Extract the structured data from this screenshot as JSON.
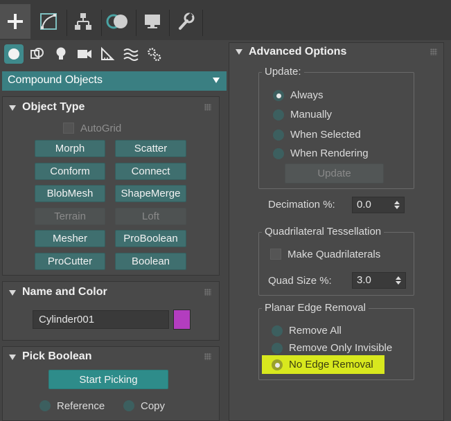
{
  "dropdown": {
    "value": "Compound Objects"
  },
  "object_type": {
    "title": "Object Type",
    "autogrid": "AutoGrid",
    "buttons": [
      "Morph",
      "Scatter",
      "Conform",
      "Connect",
      "BlobMesh",
      "ShapeMerge",
      "Terrain",
      "Loft",
      "Mesher",
      "ProBoolean",
      "ProCutter",
      "Boolean"
    ]
  },
  "name_color": {
    "title": "Name and Color",
    "name": "Cylinder001",
    "swatch": "#b33dbf"
  },
  "pick_boolean": {
    "title": "Pick Boolean",
    "start": "Start Picking",
    "reference": "Reference",
    "copy": "Copy"
  },
  "advanced": {
    "title": "Advanced Options",
    "update_group": "Update:",
    "always": "Always",
    "manually": "Manually",
    "when_selected": "When Selected",
    "when_rendering": "When Rendering",
    "update_btn": "Update",
    "decimation_label": "Decimation %:",
    "decimation_value": "0.0",
    "quad_group": "Quadrilateral Tessellation",
    "make_quads": "Make Quadrilaterals",
    "quad_size_label": "Quad Size %:",
    "quad_size_value": "3.0",
    "planar_group": "Planar Edge Removal",
    "remove_all": "Remove All",
    "remove_invisible": "Remove Only Invisible",
    "no_edge": "No Edge Removal"
  },
  "colors": {
    "accent": "#3a7f82",
    "highlight": "#d8e81e",
    "bg": "#444444"
  }
}
